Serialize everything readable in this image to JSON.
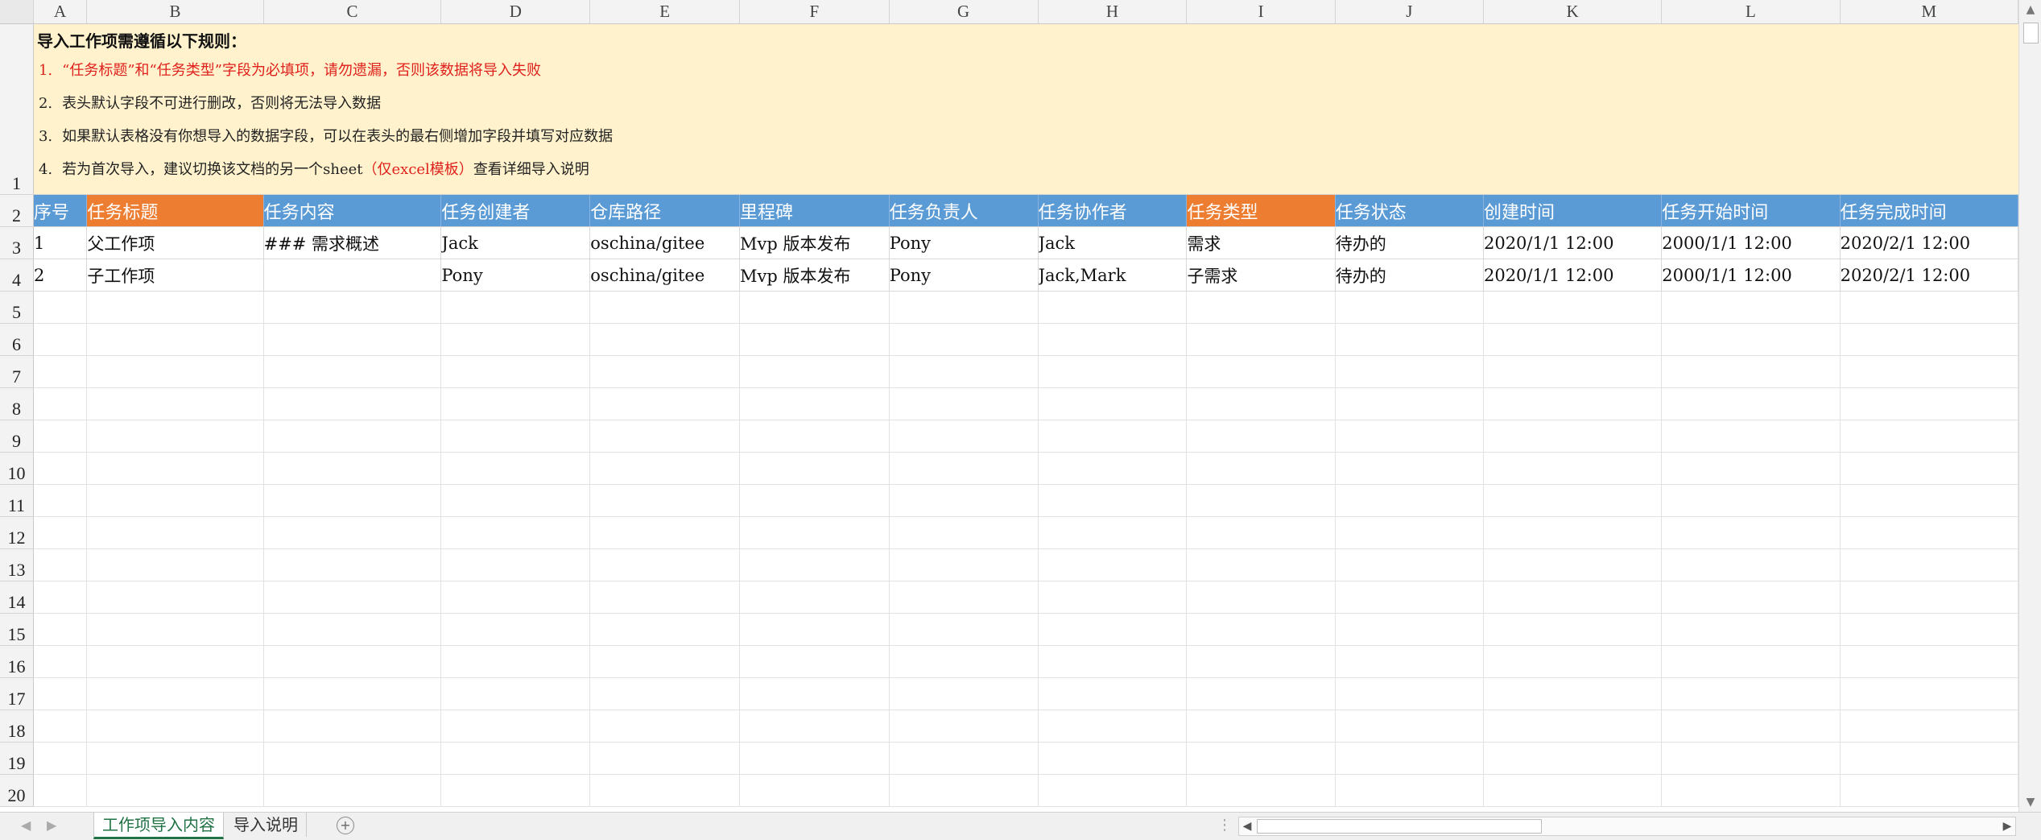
{
  "columns": [
    "A",
    "B",
    "C",
    "D",
    "E",
    "F",
    "G",
    "H",
    "I",
    "J",
    "K",
    "L",
    "M"
  ],
  "instructions": {
    "title": "导入工作项需遵循以下规则：",
    "rules": [
      {
        "num": "1.",
        "text": "“任务标题”和“任务类型”字段为必填项，请勿遗漏，否则该数据将导入失败"
      },
      {
        "num": "2.",
        "text": "表头默认字段不可进行删改，否则将无法导入数据"
      },
      {
        "num": "3.",
        "text": "如果默认表格没有你想导入的数据字段，可以在表头的最右侧增加字段并填写对应数据"
      },
      {
        "num": "4.",
        "text_before": "若为首次导入，建议切换该文档的另一个sheet",
        "text_highlight": "（仅excel模板）",
        "text_after": "查看详细导入说明"
      }
    ]
  },
  "headers": [
    "序号",
    "任务标题",
    "任务内容",
    "任务创建者",
    "仓库路径",
    "里程碑",
    "任务负责人",
    "任务协作者",
    "任务类型",
    "任务状态",
    "创建时间",
    "任务开始时间",
    "任务完成时间"
  ],
  "rows": [
    [
      "1",
      "父工作项",
      "### 需求概述",
      "Jack",
      "oschina/gitee",
      "Mvp 版本发布",
      "Pony",
      "Jack",
      "需求",
      "待办的",
      "2020/1/1 12:00",
      "2000/1/1 12:00",
      "2020/2/1 12:00"
    ],
    [
      "2",
      "子工作项",
      "",
      "Pony",
      "oschina/gitee",
      "Mvp 版本发布",
      "Pony",
      "Jack,Mark",
      "子需求",
      "待办的",
      "2020/1/1 12:00",
      "2000/1/1 12:00",
      "2020/2/1 12:00"
    ]
  ],
  "row_numbers": [
    "1",
    "2",
    "3",
    "4",
    "5",
    "6",
    "7",
    "8",
    "9",
    "10",
    "11",
    "12",
    "13",
    "14",
    "15",
    "16",
    "17",
    "18",
    "19",
    "20"
  ],
  "colors": {
    "header_blue": "#5b9bd5",
    "header_orange": "#ed7d31",
    "notes_bg": "#fff2cc",
    "required_red": "#e0201c",
    "active_tab": "#217346"
  },
  "sheet_tabs": [
    {
      "label": "工作项导入内容",
      "active": true
    },
    {
      "label": "导入说明",
      "active": false
    }
  ],
  "icons": {
    "add_sheet": "plus-circle-icon",
    "scroll_up": "arrow-up-icon",
    "scroll_down": "arrow-down-icon"
  }
}
